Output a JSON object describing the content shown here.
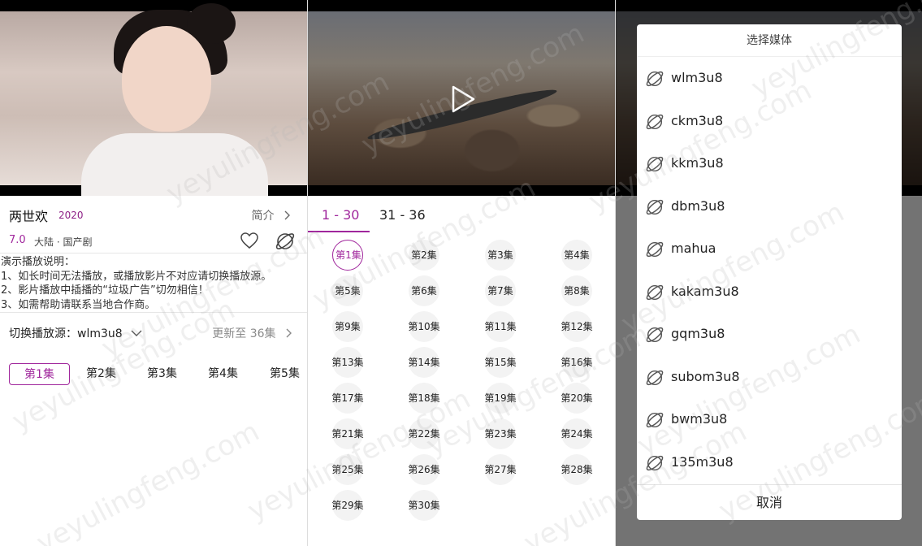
{
  "screen1": {
    "show_title": "两世欢",
    "year": "2020",
    "intro_link": "简介",
    "rating": "7.0",
    "genre": "大陆 · 国产剧",
    "notice_lines": [
      "演示播放说明：",
      "1、如长时间无法播放，或播放影片不对应请切换播放源。",
      "2、影片播放中插播的“垃圾广告”切勿相信！",
      "3、如需帮助请联系当地合作商。"
    ],
    "source_label": "切换播放源：wlm3u8",
    "updated": "更新至 36集",
    "episodes": [
      "第1集",
      "第2集",
      "第3集",
      "第4集",
      "第5集"
    ]
  },
  "screen2": {
    "tabs": [
      "1 - 30",
      "31 - 36"
    ],
    "episodes": [
      "第1集",
      "第2集",
      "第3集",
      "第4集",
      "第5集",
      "第6集",
      "第7集",
      "第8集",
      "第9集",
      "第10集",
      "第11集",
      "第12集",
      "第13集",
      "第14集",
      "第15集",
      "第16集",
      "第17集",
      "第18集",
      "第19集",
      "第20集",
      "第21集",
      "第22集",
      "第23集",
      "第24集",
      "第25集",
      "第26集",
      "第27集",
      "第28集",
      "第29集",
      "第30集"
    ]
  },
  "screen3": {
    "dialog_title": "选择媒体",
    "media_sources": [
      "wlm3u8",
      "ckm3u8",
      "kkm3u8",
      "dbm3u8",
      "mahua",
      "kakam3u8",
      "gqm3u8",
      "subom3u8",
      "bwm3u8",
      "135m3u8"
    ],
    "cancel_label": "取消"
  },
  "watermark": "yeyulingfeng.com",
  "colors": {
    "accent": "#a0269c"
  }
}
